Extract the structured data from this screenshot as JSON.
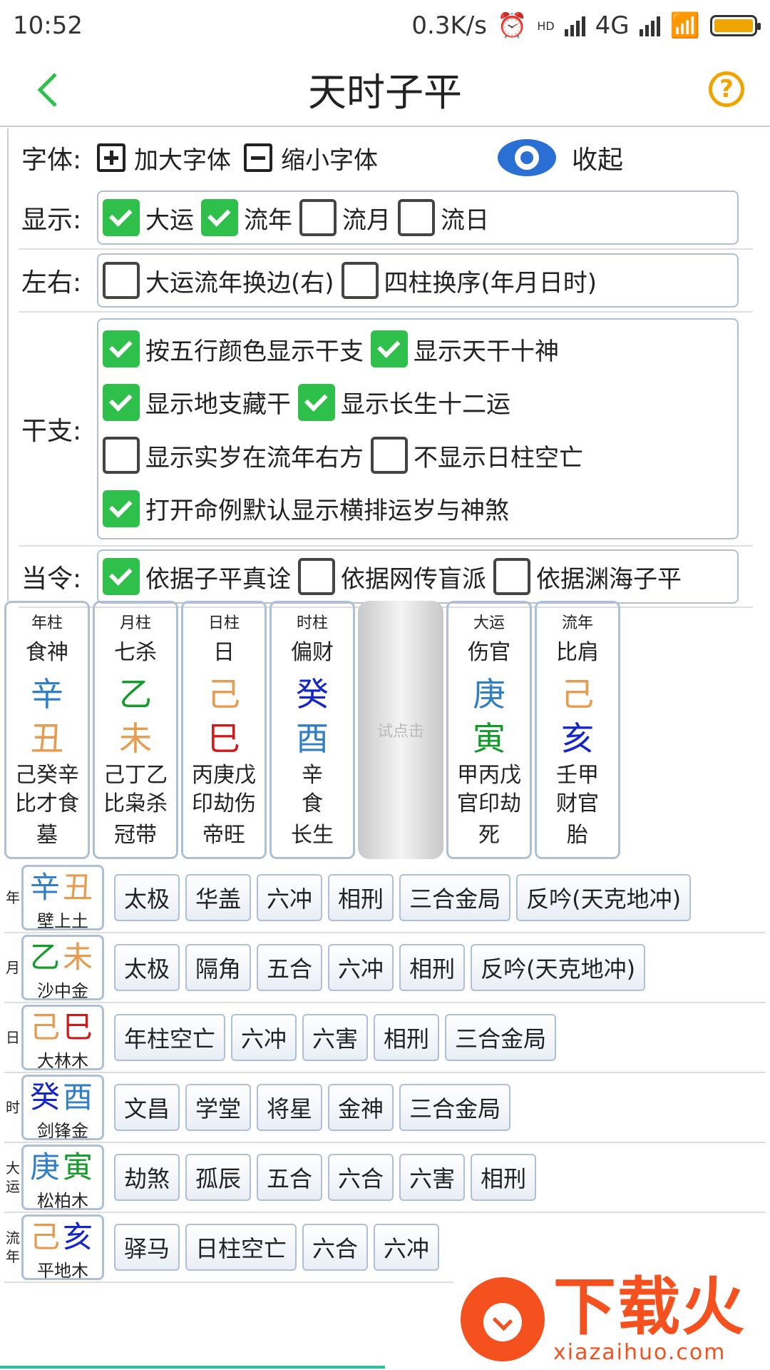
{
  "status": {
    "time": "10:52",
    "speed": "0.3K/s",
    "net_hd": "HD",
    "net": "4G"
  },
  "title": "天时子平",
  "font_row": {
    "label": "字体:",
    "enlarge": "加大字体",
    "shrink": "缩小字体",
    "collapse": "收起"
  },
  "display_row": {
    "label": "显示:",
    "items": [
      {
        "label": "大运",
        "checked": true
      },
      {
        "label": "流年",
        "checked": true
      },
      {
        "label": "流月",
        "checked": false
      },
      {
        "label": "流日",
        "checked": false
      }
    ]
  },
  "lr_row": {
    "label": "左右:",
    "items": [
      {
        "label": "大运流年换边(右)",
        "checked": false
      },
      {
        "label": "四柱换序(年月日时)",
        "checked": false
      }
    ]
  },
  "gz_row": {
    "label": "干支:",
    "items": [
      {
        "label": "按五行颜色显示干支",
        "checked": true
      },
      {
        "label": "显示天干十神",
        "checked": true
      },
      {
        "label": "显示地支藏干",
        "checked": true
      },
      {
        "label": "显示长生十二运",
        "checked": true
      },
      {
        "label": "显示实岁在流年右方",
        "checked": false
      },
      {
        "label": "不显示日柱空亡",
        "checked": false
      },
      {
        "label": "打开命例默认显示横排运岁与神煞",
        "checked": true
      }
    ]
  },
  "dl_row": {
    "label": "当令:",
    "items": [
      {
        "label": "依据子平真诠",
        "checked": true
      },
      {
        "label": "依据网传盲派",
        "checked": false
      },
      {
        "label": "依据渊海子平",
        "checked": false
      }
    ]
  },
  "pillars": [
    {
      "head": "年柱",
      "shishen": "食神",
      "gan": "辛",
      "gan_color": "#2f7fc6",
      "zhi": "丑",
      "zhi_color": "#e89a4e",
      "hide1": "己癸辛",
      "hide2": "比才食",
      "cs": "墓"
    },
    {
      "head": "月柱",
      "shishen": "七杀",
      "gan": "乙",
      "gan_color": "#149b2a",
      "zhi": "未",
      "zhi_color": "#e89a4e",
      "hide1": "己丁乙",
      "hide2": "比枭杀",
      "cs": "冠带"
    },
    {
      "head": "日柱",
      "shishen": "日",
      "gan": "己",
      "gan_color": "#e89a4e",
      "zhi": "巳",
      "zhi_color": "#d01818",
      "hide1": "丙庚戊",
      "hide2": "印劫伤",
      "cs": "帝旺"
    },
    {
      "head": "时柱",
      "shishen": "偏财",
      "gan": "癸",
      "gan_color": "#1426c8",
      "zhi": "酉",
      "zhi_color": "#2f7fc6",
      "hide1": "辛",
      "hide2": "食",
      "cs": "长生"
    }
  ],
  "try_click": "试点击",
  "yun_pillars": [
    {
      "head": "大运",
      "shishen": "伤官",
      "gan": "庚",
      "gan_color": "#2f7fc6",
      "zhi": "寅",
      "zhi_color": "#149b2a",
      "hide1": "甲丙戊",
      "hide2": "官印劫",
      "cs": "死"
    },
    {
      "head": "流年",
      "shishen": "比肩",
      "gan": "己",
      "gan_color": "#e89a4e",
      "zhi": "亥",
      "zhi_color": "#1426c8",
      "hide1": "壬甲",
      "hide2": "财官",
      "cs": "胎"
    }
  ],
  "relations": [
    {
      "side": "年",
      "gan": "辛",
      "gan_color": "#2f7fc6",
      "zhi": "丑",
      "zhi_color": "#e89a4e",
      "nayin": "壁上土",
      "tags": [
        "太极",
        "华盖",
        "六冲",
        "相刑",
        "三合金局",
        "反吟(天克地冲)"
      ]
    },
    {
      "side": "月",
      "gan": "乙",
      "gan_color": "#149b2a",
      "zhi": "未",
      "zhi_color": "#e89a4e",
      "nayin": "沙中金",
      "tags": [
        "太极",
        "隔角",
        "五合",
        "六冲",
        "相刑",
        "反吟(天克地冲)"
      ]
    },
    {
      "side": "日",
      "gan": "己",
      "gan_color": "#e89a4e",
      "zhi": "巳",
      "zhi_color": "#d01818",
      "nayin": "大林木",
      "tags": [
        "年柱空亡",
        "六冲",
        "六害",
        "相刑",
        "三合金局"
      ]
    },
    {
      "side": "时",
      "gan": "癸",
      "gan_color": "#1426c8",
      "zhi": "酉",
      "zhi_color": "#2f7fc6",
      "nayin": "剑锋金",
      "tags": [
        "文昌",
        "学堂",
        "将星",
        "金神",
        "三合金局"
      ]
    },
    {
      "side": "大运",
      "gan": "庚",
      "gan_color": "#2f7fc6",
      "zhi": "寅",
      "zhi_color": "#149b2a",
      "nayin": "松柏木",
      "tags": [
        "劫煞",
        "孤辰",
        "五合",
        "六合",
        "六害",
        "相刑"
      ]
    },
    {
      "side": "流年",
      "gan": "己",
      "gan_color": "#e89a4e",
      "zhi": "亥",
      "zhi_color": "#1426c8",
      "nayin": "平地木",
      "tags": [
        "驿马",
        "日柱空亡",
        "六合",
        "六冲"
      ]
    }
  ],
  "watermark": {
    "brand": "下载火",
    "url": "xiazaihuo.com"
  }
}
